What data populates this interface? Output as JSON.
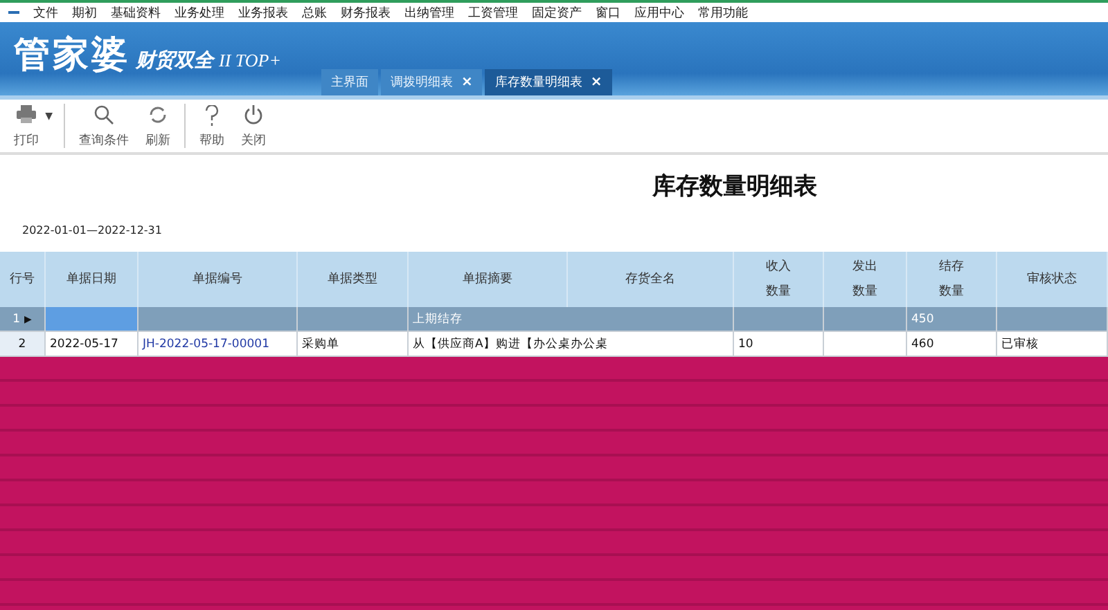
{
  "menu": [
    "文件",
    "期初",
    "基础资料",
    "业务处理",
    "业务报表",
    "总账",
    "财务报表",
    "出纳管理",
    "工资管理",
    "固定资产",
    "窗口",
    "应用中心",
    "常用功能"
  ],
  "brand": {
    "name": "管家婆",
    "edition": "财贸双全",
    "version": "II TOP+"
  },
  "tabs": [
    {
      "label": "主界面",
      "selected": false
    },
    {
      "label": "调拨明细表",
      "close": "×",
      "selected": false
    },
    {
      "label": "库存数量明细表",
      "close": "×",
      "selected": true
    }
  ],
  "toolbar": [
    {
      "kind": "print",
      "label": "打印",
      "menu": "▼"
    },
    {
      "kind": "search",
      "label": "查询条件"
    },
    {
      "kind": "refresh",
      "label": "刷新"
    },
    {
      "kind": "help",
      "label": "帮助"
    },
    {
      "kind": "power",
      "label": "关闭"
    }
  ],
  "report": {
    "title": "库存数量明细表",
    "period": "2022-01-01—2022-12-31"
  },
  "table": {
    "current_marker": "▶",
    "columns": [
      "行号",
      "单据日期",
      "单据编号",
      "单据类型",
      "单据摘要",
      "存货全名",
      "收入数量",
      "发出数量",
      "结存数量",
      "审核状态"
    ],
    "rows": [
      {
        "kind": "opening",
        "selected": true,
        "cells": [
          "1",
          "",
          "",
          "",
          "上期结存",
          "",
          "",
          "",
          "450",
          ""
        ]
      },
      {
        "kind": "entry",
        "selected": false,
        "cells": [
          "2",
          "2022-05-17",
          "JH-2022-05-17-00001",
          "采购单",
          "从【供应商A】购进【办公桌办公桌",
          "",
          "10",
          "",
          "460",
          "已审核"
        ]
      }
    ]
  }
}
